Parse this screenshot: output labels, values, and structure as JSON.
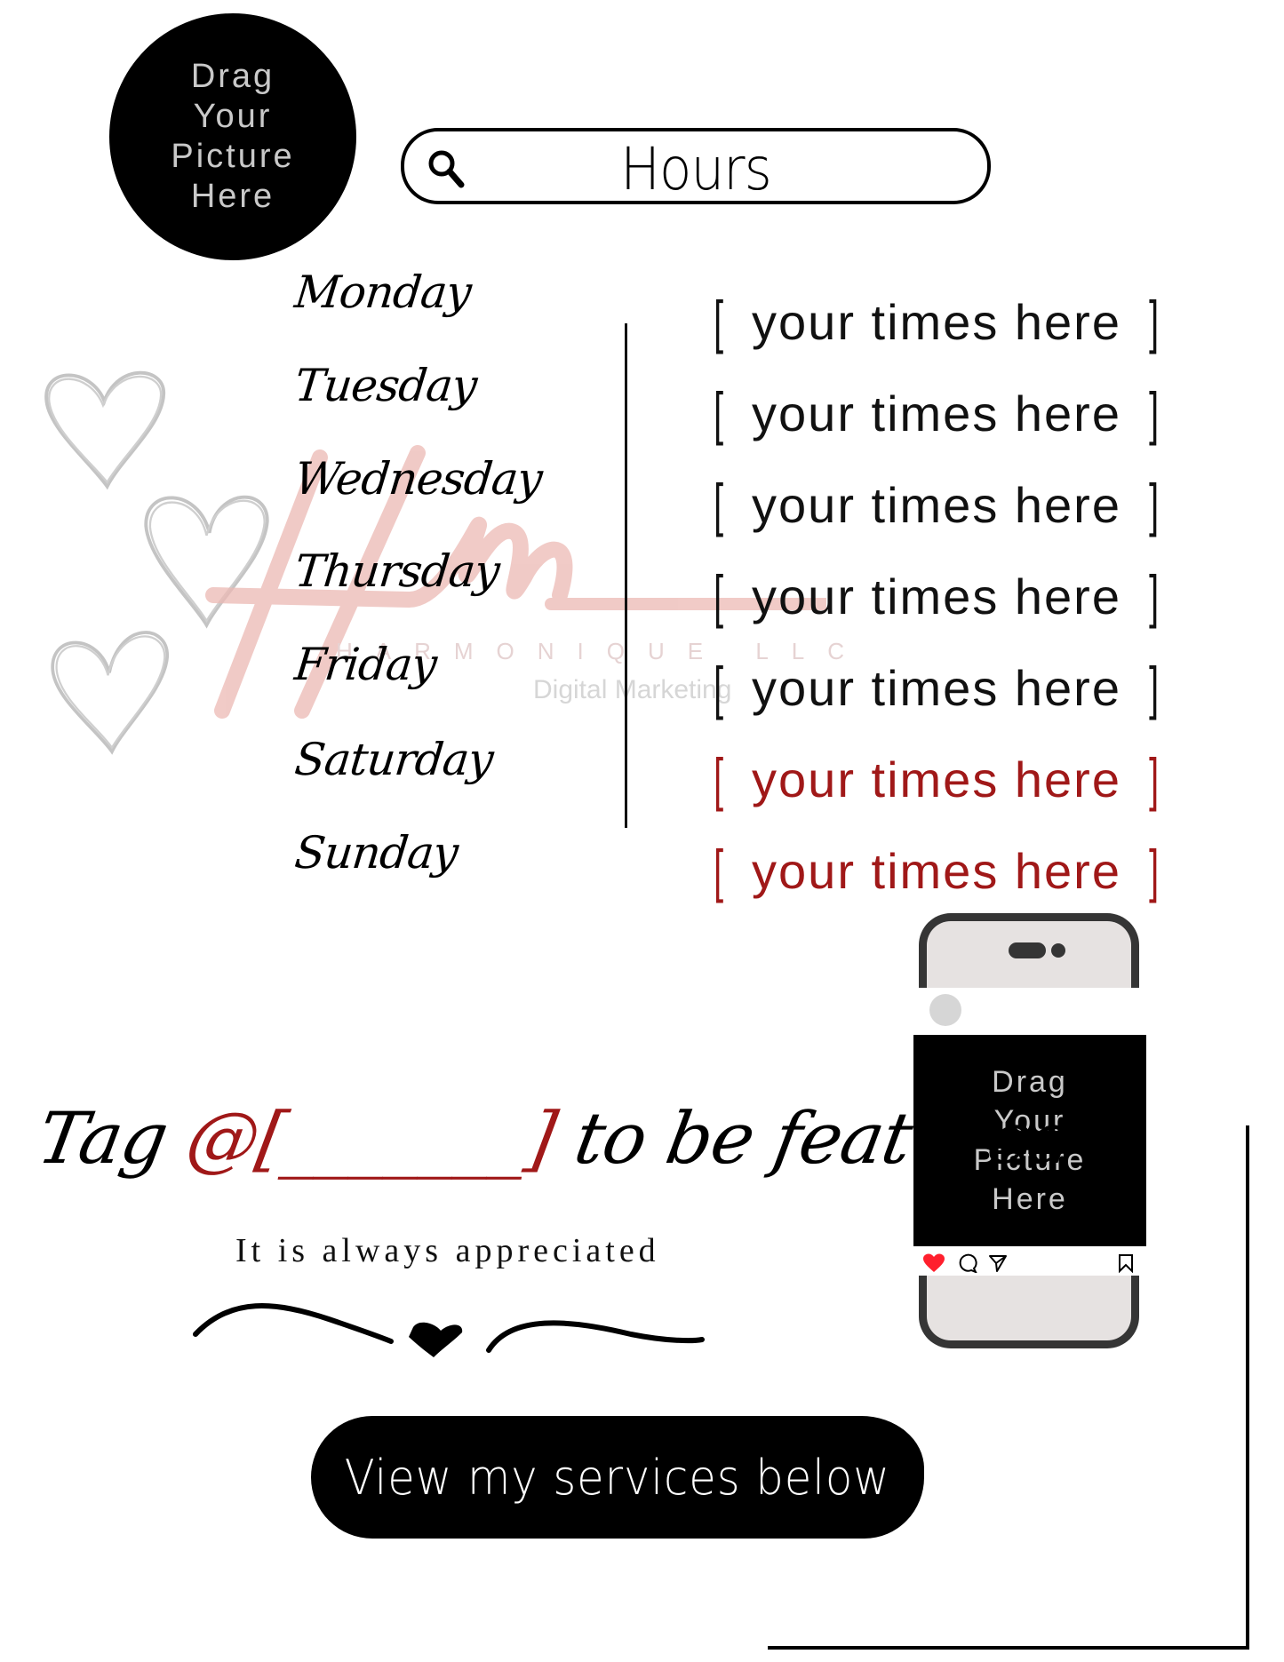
{
  "profile": {
    "placeholder": "Drag\nYour\nPicture\nHere",
    "icon": "profile-photo-placeholder"
  },
  "search_bar": {
    "icon": "search-icon",
    "title": "Hours"
  },
  "schedule": {
    "days": [
      {
        "day": "Monday",
        "times": "your times here",
        "highlight": false
      },
      {
        "day": "Tuesday",
        "times": "your times here",
        "highlight": false
      },
      {
        "day": "Wednesday",
        "times": "your times here",
        "highlight": false
      },
      {
        "day": "Thursday",
        "times": "your times here",
        "highlight": false
      },
      {
        "day": "Friday",
        "times": "your times here",
        "highlight": false
      },
      {
        "day": "Saturday",
        "times": "your times here",
        "highlight": true
      },
      {
        "day": "Sunday",
        "times": "your times here",
        "highlight": true
      }
    ],
    "bracket_open": "[",
    "bracket_close": "]"
  },
  "watermark": {
    "logo": "Hm",
    "company": "HARMONIQUE LLC",
    "tagline": "Digital Marketing"
  },
  "tag_section": {
    "prefix": "Tag ",
    "handle": "@[_______]",
    "suffix": " to be featured",
    "subtitle": "It is always appreciated"
  },
  "phone_mockup": {
    "post_placeholder": "Drag\nYour\nPicture\nHere",
    "actions": [
      "heart-icon",
      "comment-icon",
      "share-icon",
      "bookmark-icon"
    ]
  },
  "cta": {
    "label": "View my services below"
  },
  "colors": {
    "accent_red": "#a01818",
    "like_red": "#ff1f2d",
    "black": "#000000",
    "heart_outline_gray": "#c4c4c4",
    "phone_frame": "#353535",
    "phone_screen": "#e6e2e1"
  }
}
